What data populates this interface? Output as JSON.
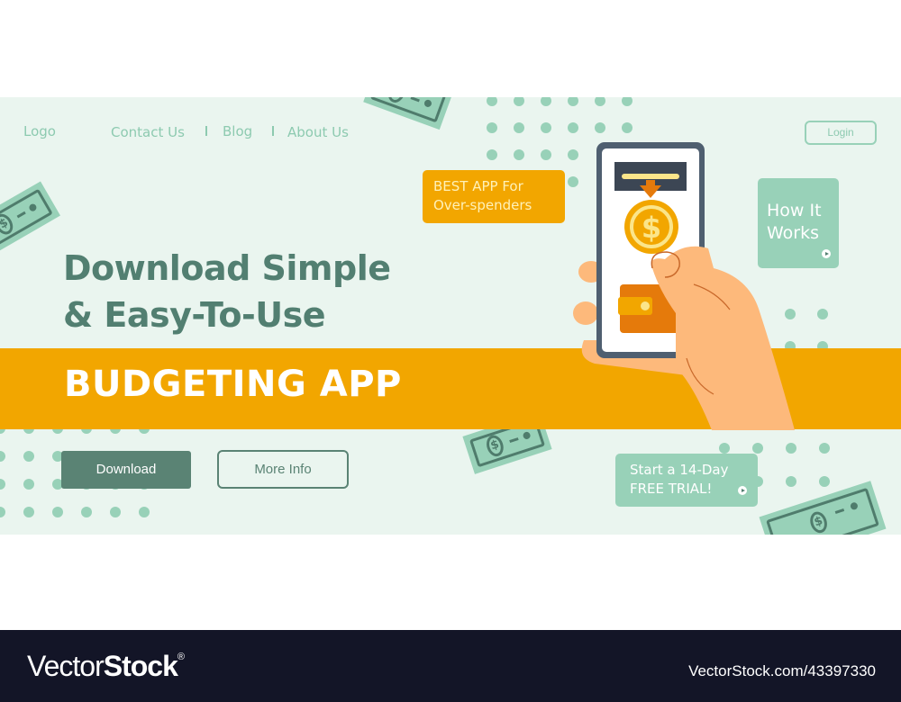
{
  "nav": {
    "logo": "Logo",
    "links": [
      "Contact Us",
      "Blog",
      "About Us"
    ],
    "login_label": "Login"
  },
  "hero": {
    "headline_line1": "Download Simple",
    "headline_line2": "& Easy-To-Use",
    "band_title": "BUDGETING APP",
    "download_label": "Download",
    "more_info_label": "More Info"
  },
  "badges": {
    "best_app_line1": "BEST APP For",
    "best_app_line2": "Over-spenders",
    "how_it_works_line1": "How It",
    "how_it_works_line2": "Works",
    "trial_line1": "Start a 14-Day",
    "trial_line2": "FREE TRIAL!"
  },
  "illustration": {
    "coin_symbol": "$",
    "bill_symbol": "$"
  },
  "colors": {
    "background": "#eaf5ef",
    "mint": "#98d1b8",
    "dark_green": "#527f71",
    "orange": "#f2a600",
    "footer": "#131527"
  },
  "footer": {
    "brand_thin": "Vector",
    "brand_bold": "Stock",
    "brand_mark": "®",
    "image_id": "VectorStock.com/43397330"
  }
}
